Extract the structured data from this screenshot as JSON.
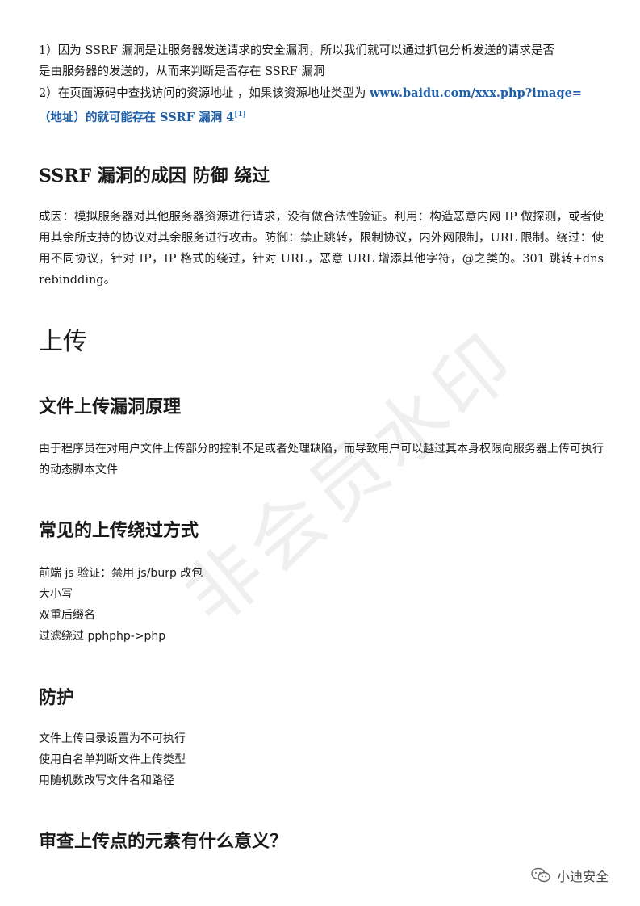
{
  "p1": "1）因为 SSRF 漏洞是让服务器发送请求的安全漏洞，所以我们就可以通过抓包分析发送的请求是否",
  "p1b": "是由服务器的发送的，从而来判断是否存在 SSRF 漏洞",
  "p2a": "2）在页面源码中查找访问的资源地址 ，如果该资源地址类型为 ",
  "p2link": "www.baidu.com/xxx.php?image=",
  "p2b": "（地址）的就可能存在 SSRF 漏洞  4",
  "p2sup": "[1]",
  "h_ssrf": "SSRF 漏洞的成因  防御  绕过",
  "ssrf_para": "成因：模拟服务器对其他服务器资源进行请求，没有做合法性验证。利用：构造恶意内网 IP 做探测，或者使用其余所支持的协议对其余服务进行攻击。防御：禁止跳转，限制协议，内外网限制，URL 限制。绕过：使用不同协议，针对 IP，IP 格式的绕过，针对 URL，恶意 URL 增添其他字符，@之类的。301 跳转+dns rebindding。",
  "h_upload": "上传",
  "h_principle": "文件上传漏洞原理",
  "principle_para": "由于程序员在对用户文件上传部分的控制不足或者处理缺陷，而导致用户可以越过其本身权限向服务器上传可执行的动态脚本文件",
  "h_bypass": "常见的上传绕过方式",
  "bypass": [
    "前端 js 验证：禁用 js/burp 改包",
    "大小写",
    "双重后缀名",
    "过滤绕过  pphphp->php"
  ],
  "h_protect": "防护",
  "protect": [
    "文件上传目录设置为不可执行",
    "使用白名单判断文件上传类型",
    "用随机数改写文件名和路径"
  ],
  "h_question": "审查上传点的元素有什么意义？",
  "watermark": "非会员水印",
  "brand": "小迪安全",
  "colors": {
    "link": "#1f5fa8"
  }
}
